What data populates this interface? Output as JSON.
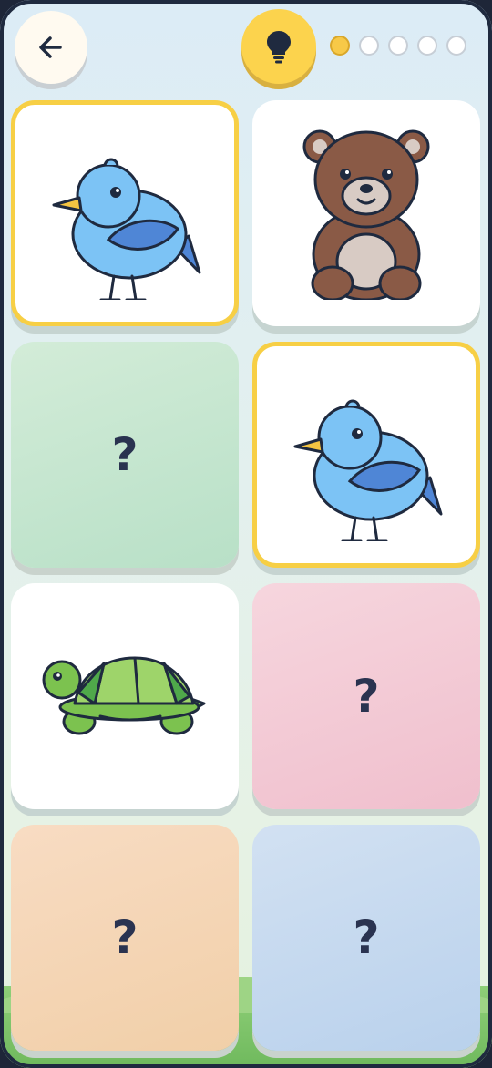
{
  "header": {
    "back_icon": "arrow-left-icon",
    "hint_icon": "lightbulb-icon",
    "progress": {
      "total": 5,
      "completed": 1
    },
    "colors": {
      "hint": "#fcd34d",
      "progress_filled": "#f7c948",
      "selected_border": "#f7cf45"
    }
  },
  "board": {
    "cards": [
      {
        "state": "face-up",
        "animal": "bird",
        "selected": true
      },
      {
        "state": "face-up",
        "animal": "bear",
        "selected": false
      },
      {
        "state": "face-down",
        "symbol": "?",
        "color": "#c6e6d0"
      },
      {
        "state": "face-up",
        "animal": "bird",
        "selected": true
      },
      {
        "state": "face-up",
        "animal": "turtle",
        "selected": false
      },
      {
        "state": "face-down",
        "symbol": "?",
        "color": "#f3cad5"
      },
      {
        "state": "face-down",
        "symbol": "?",
        "color": "#f4d6b6"
      },
      {
        "state": "face-down",
        "symbol": "?",
        "color": "#c6daf0"
      }
    ]
  }
}
